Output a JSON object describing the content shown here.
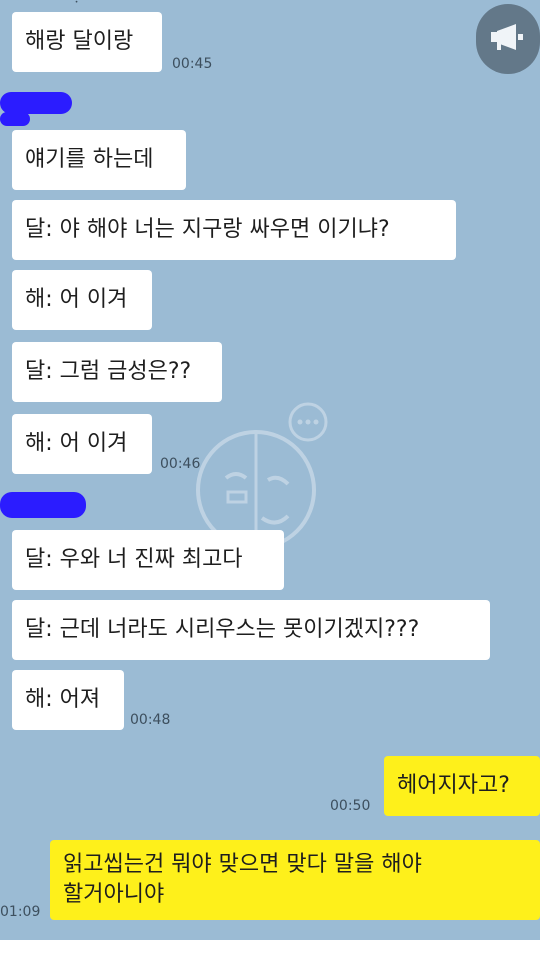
{
  "messages": [
    {
      "text": "해랑 달이랑",
      "time": "00:45"
    },
    {
      "text": "얘기를 하는데"
    },
    {
      "text": "달: 야 해야 너는 지구랑 싸우면 이기냐?"
    },
    {
      "text": "해: 어 이겨"
    },
    {
      "text": "달: 그럼 금성은??"
    },
    {
      "text": "해: 어 이겨",
      "time": "00:46"
    },
    {
      "text": "달: 우와 너 진짜 최고다"
    },
    {
      "text": "달: 근데 너라도 시리우스는 못이기겠지???"
    },
    {
      "text": "해: 어져",
      "time": "00:48"
    },
    {
      "text": "헤어지자고?",
      "time": "00:50"
    },
    {
      "text_line1": "읽고씹는건 뭐야 맞으면 맞다 말을 해야",
      "text_line2": "할거아니야",
      "time": "01:09"
    }
  ],
  "icons": {
    "megaphone": "megaphone-icon",
    "watermark": "watermark-face-icon"
  },
  "colors": {
    "background": "#9bbbd4",
    "incoming_bubble": "#ffffff",
    "outgoing_bubble": "#fef01b",
    "redaction": "#2b1cff"
  }
}
